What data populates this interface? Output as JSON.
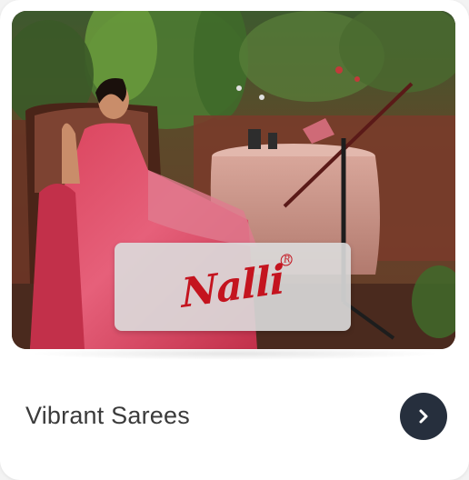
{
  "card": {
    "title": "Vibrant Sarees",
    "brand_logo_text": "Nalli",
    "brand_logo_mark": "R",
    "next_icon": "chevron-right-icon",
    "colors": {
      "card_bg": "#ffffff",
      "brand_red": "#c4141f",
      "button_bg": "#262f3d",
      "title_text": "#3b3b3b"
    }
  }
}
